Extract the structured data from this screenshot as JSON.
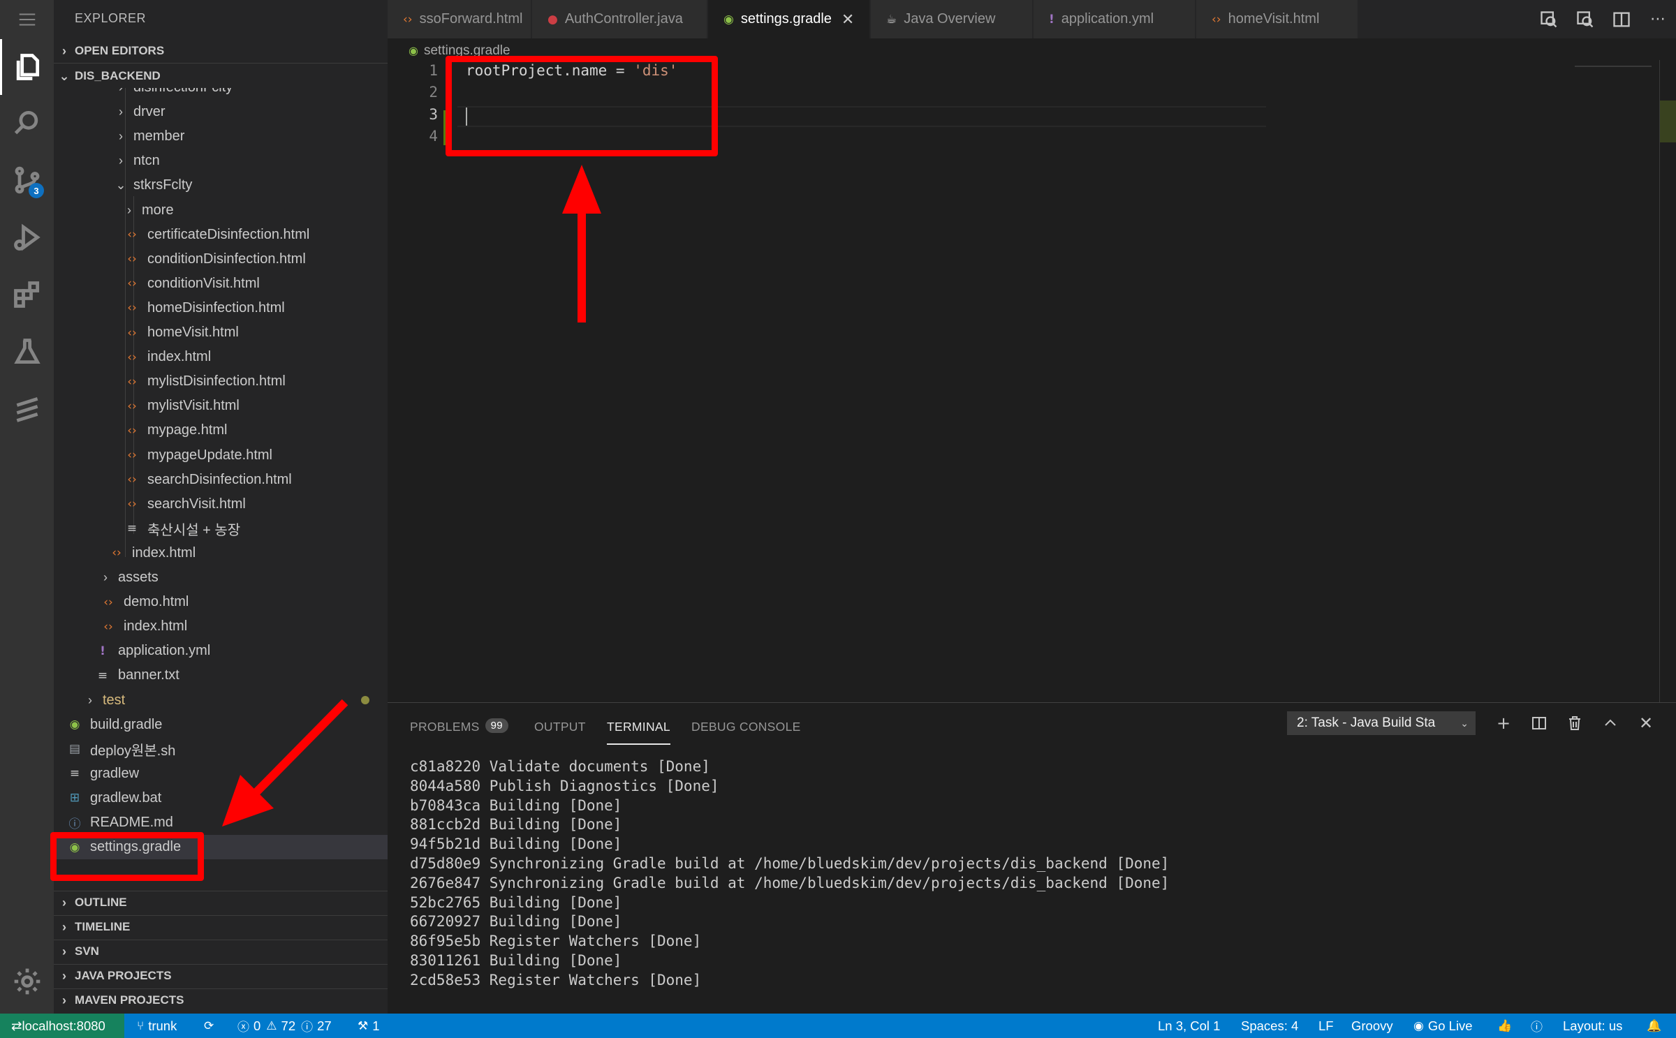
{
  "sidebar": {
    "title": "EXPLORER",
    "sections": {
      "open_editors": "OPEN EDITORS",
      "project": "DIS_BACKEND",
      "outline": "OUTLINE",
      "timeline": "TIMELINE",
      "svn": "SVN",
      "java_projects": "JAVA PROJECTS",
      "maven_projects": "MAVEN PROJECTS"
    },
    "tree": [
      {
        "label": "disinfectionFcity",
        "icon": "chevron-right",
        "kind": "folder"
      },
      {
        "label": "drver",
        "icon": "chevron-right",
        "kind": "folder"
      },
      {
        "label": "member",
        "icon": "chevron-right",
        "kind": "folder"
      },
      {
        "label": "ntcn",
        "icon": "chevron-right",
        "kind": "folder"
      },
      {
        "label": "stkrsFclty",
        "icon": "chevron-down",
        "kind": "folder"
      },
      {
        "label": "more",
        "icon": "chevron-right",
        "kind": "folder"
      },
      {
        "label": "certificateDisinfection.html",
        "icon": "html-file-icon",
        "kind": "html"
      },
      {
        "label": "conditionDisinfection.html",
        "icon": "html-file-icon",
        "kind": "html"
      },
      {
        "label": "conditionVisit.html",
        "icon": "html-file-icon",
        "kind": "html"
      },
      {
        "label": "homeDisinfection.html",
        "icon": "html-file-icon",
        "kind": "html"
      },
      {
        "label": "homeVisit.html",
        "icon": "html-file-icon",
        "kind": "html"
      },
      {
        "label": "index.html",
        "icon": "html-file-icon",
        "kind": "html"
      },
      {
        "label": "mylistDisinfection.html",
        "icon": "html-file-icon",
        "kind": "html"
      },
      {
        "label": "mylistVisit.html",
        "icon": "html-file-icon",
        "kind": "html"
      },
      {
        "label": "mypage.html",
        "icon": "html-file-icon",
        "kind": "html"
      },
      {
        "label": "mypageUpdate.html",
        "icon": "html-file-icon",
        "kind": "html"
      },
      {
        "label": "searchDisinfection.html",
        "icon": "html-file-icon",
        "kind": "html"
      },
      {
        "label": "searchVisit.html",
        "icon": "html-file-icon",
        "kind": "html"
      },
      {
        "label": "축산시설 + 농장",
        "icon": "text-file-icon",
        "kind": "txt"
      },
      {
        "label": "index.html",
        "icon": "html-file-icon",
        "kind": "html"
      },
      {
        "label": "assets",
        "icon": "chevron-right",
        "kind": "folder"
      },
      {
        "label": "demo.html",
        "icon": "html-file-icon",
        "kind": "html"
      },
      {
        "label": "index.html",
        "icon": "html-file-icon",
        "kind": "html"
      },
      {
        "label": "application.yml",
        "icon": "yaml-file-icon",
        "kind": "yml"
      },
      {
        "label": "banner.txt",
        "icon": "text-file-icon",
        "kind": "txt"
      },
      {
        "label": "test",
        "icon": "chevron-right",
        "kind": "folder"
      },
      {
        "label": "build.gradle",
        "icon": "gradle-file-icon",
        "kind": "gradle"
      },
      {
        "label": "deploy원본.sh",
        "icon": "shell-file-icon",
        "kind": "sh"
      },
      {
        "label": "gradlew",
        "icon": "text-file-icon",
        "kind": "txt"
      },
      {
        "label": "gradlew.bat",
        "icon": "windows-file-icon",
        "kind": "bat"
      },
      {
        "label": "README.md",
        "icon": "info-file-icon",
        "kind": "md"
      },
      {
        "label": "settings.gradle",
        "icon": "gradle-file-icon",
        "kind": "gradle"
      }
    ]
  },
  "activity_bar": {
    "source_control_badge": "3"
  },
  "tabs": [
    {
      "label": "ssoForward.html",
      "icon": "html-file-icon"
    },
    {
      "label": "AuthController.java",
      "icon": "java-file-icon"
    },
    {
      "label": "settings.gradle",
      "icon": "gradle-file-icon",
      "active": true
    },
    {
      "label": "Java Overview",
      "icon": "java-overview-icon"
    },
    {
      "label": "application.yml",
      "icon": "yaml-file-icon"
    },
    {
      "label": "homeVisit.html",
      "icon": "html-file-icon"
    }
  ],
  "breadcrumb": "settings.gradle",
  "editor": {
    "line_numbers": [
      "1",
      "2",
      "3",
      "4"
    ],
    "code_prefix": "rootProject.name = ",
    "code_string": "'dis'"
  },
  "panel": {
    "tabs": [
      "PROBLEMS",
      "OUTPUT",
      "TERMINAL",
      "DEBUG CONSOLE"
    ],
    "problems_count": "99",
    "terminal_selector": "2: Task - Java Build Sta",
    "terminal_lines": [
      "c81a8220 Validate documents [Done]",
      "8044a580 Publish Diagnostics [Done]",
      "b70843ca Building [Done]",
      "881ccb2d Building [Done]",
      "94f5b21d Building [Done]",
      "d75d80e9 Synchronizing Gradle build at /home/bluedskim/dev/projects/dis_backend [Done]",
      "2676e847 Synchronizing Gradle build at /home/bluedskim/dev/projects/dis_backend [Done]",
      "52bc2765 Building [Done]",
      "66720927 Building [Done]",
      "86f95e5b Register Watchers [Done]",
      "83011261 Building [Done]",
      "2cd58e53 Register Watchers [Done]"
    ]
  },
  "status_bar": {
    "remote": "localhost:8080",
    "branch": "trunk",
    "errors": "0",
    "warnings": "72",
    "infos": "27",
    "ports": "1",
    "cursor_pos": "Ln 3, Col 1",
    "spaces": "Spaces: 4",
    "eol": "LF",
    "language": "Groovy",
    "go_live": "Go Live",
    "layout": "Layout: us"
  },
  "colors": {
    "annotation": "#ff0000",
    "status_bar": "#007acc",
    "remote": "#16825d"
  }
}
